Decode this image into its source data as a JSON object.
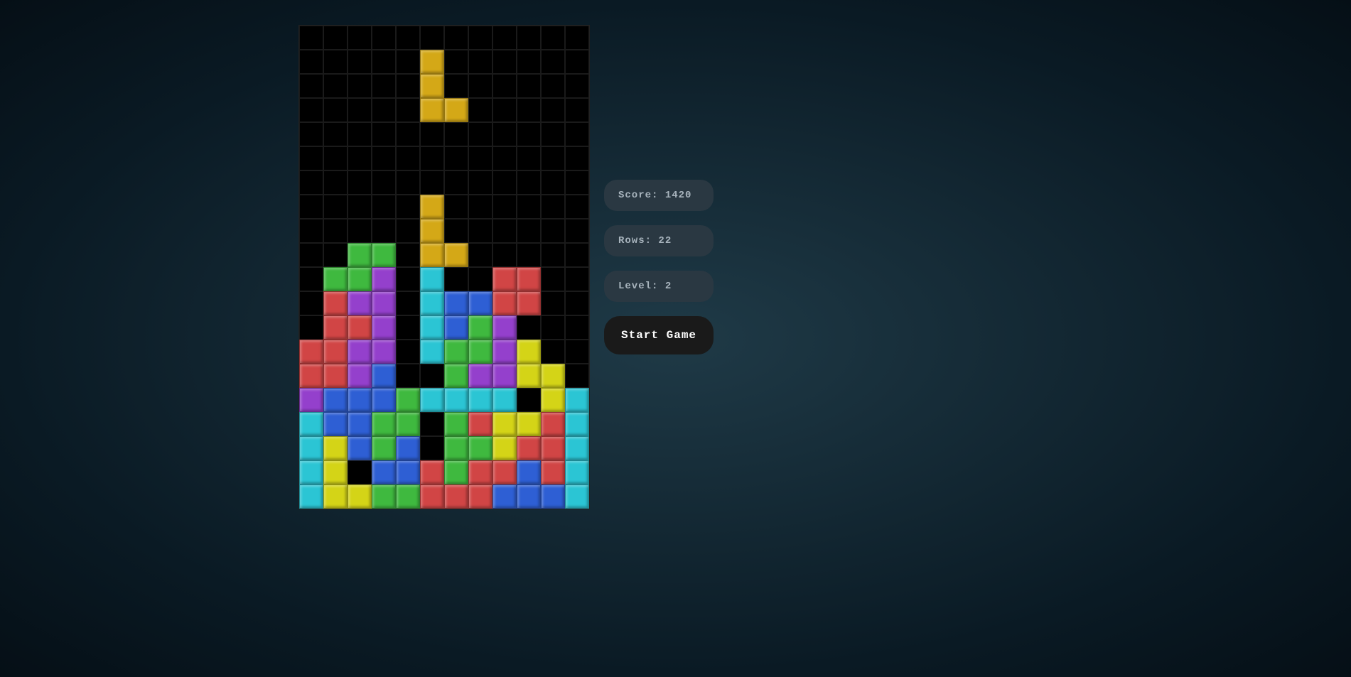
{
  "stats": {
    "score_label": "Score:",
    "score_value": "1420",
    "rows_label": "Rows:",
    "rows_value": "22",
    "level_label": "Level:",
    "level_value": "2"
  },
  "button": {
    "start_label": "Start Game"
  },
  "colors": {
    "0": "transparent",
    "C": "#2bc5d4",
    "Y": "#d4a817",
    "G": "#3fb93f",
    "R": "#d14545",
    "P": "#9440cc",
    "B": "#2e5fd4",
    "Q": "#d4d417"
  },
  "board": {
    "cols": 12,
    "rows": 20,
    "grid": [
      [
        "0",
        "0",
        "0",
        "0",
        "0",
        "0",
        "0",
        "0",
        "0",
        "0",
        "0",
        "0"
      ],
      [
        "0",
        "0",
        "0",
        "0",
        "0",
        "Y",
        "0",
        "0",
        "0",
        "0",
        "0",
        "0"
      ],
      [
        "0",
        "0",
        "0",
        "0",
        "0",
        "Y",
        "0",
        "0",
        "0",
        "0",
        "0",
        "0"
      ],
      [
        "0",
        "0",
        "0",
        "0",
        "0",
        "Y",
        "Y",
        "0",
        "0",
        "0",
        "0",
        "0"
      ],
      [
        "0",
        "0",
        "0",
        "0",
        "0",
        "0",
        "0",
        "0",
        "0",
        "0",
        "0",
        "0"
      ],
      [
        "0",
        "0",
        "0",
        "0",
        "0",
        "0",
        "0",
        "0",
        "0",
        "0",
        "0",
        "0"
      ],
      [
        "0",
        "0",
        "0",
        "0",
        "0",
        "0",
        "0",
        "0",
        "0",
        "0",
        "0",
        "0"
      ],
      [
        "0",
        "0",
        "0",
        "0",
        "0",
        "Y",
        "0",
        "0",
        "0",
        "0",
        "0",
        "0"
      ],
      [
        "0",
        "0",
        "0",
        "0",
        "0",
        "Y",
        "0",
        "0",
        "0",
        "0",
        "0",
        "0"
      ],
      [
        "0",
        "0",
        "G",
        "G",
        "0",
        "Y",
        "Y",
        "0",
        "0",
        "0",
        "0",
        "0"
      ],
      [
        "0",
        "G",
        "G",
        "P",
        "0",
        "C",
        "0",
        "0",
        "R",
        "R",
        "0",
        "0"
      ],
      [
        "0",
        "R",
        "P",
        "P",
        "0",
        "C",
        "B",
        "B",
        "R",
        "R",
        "0",
        "0"
      ],
      [
        "0",
        "R",
        "R",
        "P",
        "0",
        "C",
        "B",
        "G",
        "P",
        "0",
        "0",
        "0"
      ],
      [
        "R",
        "R",
        "P",
        "P",
        "0",
        "C",
        "G",
        "G",
        "P",
        "Q",
        "0",
        "0"
      ],
      [
        "R",
        "R",
        "P",
        "B",
        "0",
        "0",
        "G",
        "P",
        "P",
        "Q",
        "Q",
        "0"
      ],
      [
        "P",
        "B",
        "B",
        "B",
        "G",
        "C",
        "C",
        "C",
        "C",
        "0",
        "Q",
        "C"
      ],
      [
        "C",
        "B",
        "B",
        "G",
        "G",
        "0",
        "G",
        "R",
        "Q",
        "Q",
        "R",
        "C"
      ],
      [
        "C",
        "Q",
        "B",
        "G",
        "B",
        "0",
        "G",
        "G",
        "Q",
        "R",
        "R",
        "C"
      ],
      [
        "C",
        "Q",
        "0",
        "B",
        "B",
        "R",
        "G",
        "R",
        "R",
        "B",
        "R",
        "C"
      ],
      [
        "C",
        "Q",
        "Q",
        "G",
        "G",
        "R",
        "R",
        "R",
        "B",
        "B",
        "B",
        "C"
      ]
    ]
  }
}
